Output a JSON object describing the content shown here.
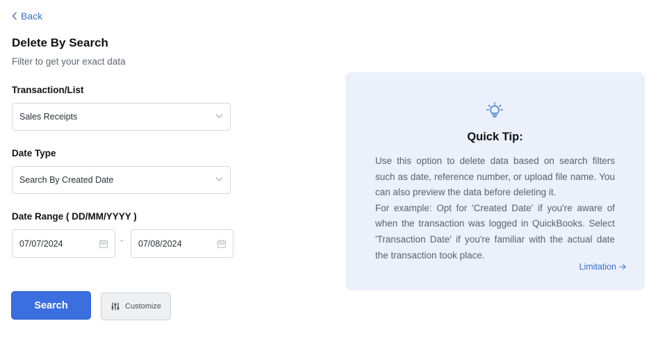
{
  "nav": {
    "back_label": "Back"
  },
  "header": {
    "title": "Delete By Search",
    "subtitle": "Filter to get your exact data"
  },
  "form": {
    "transaction": {
      "label": "Transaction/List",
      "value": "Sales Receipts"
    },
    "date_type": {
      "label": "Date Type",
      "value": "Search By Created Date"
    },
    "date_range": {
      "label": "Date Range ( DD/MM/YYYY )",
      "from": "07/07/2024",
      "separator": "-",
      "to": "07/08/2024"
    }
  },
  "actions": {
    "search_label": "Search",
    "customize_label": "Customize"
  },
  "tip": {
    "title": "Quick Tip:",
    "paragraph1": "Use this option to delete data based on search filters such as date, reference number, or upload file name. You can also preview the data before deleting it.",
    "paragraph2": "For example: Opt for 'Created Date' if you're aware of when the transaction was logged in QuickBooks. Select 'Transaction Date' if you're familiar with the actual date the transaction took place.",
    "link_label": "Limitation"
  },
  "colors": {
    "accent": "#3b6fe0",
    "link": "#3b6fd1",
    "tip_background": "#ebf0fb"
  },
  "icons": {
    "back": "chevron-left-icon",
    "select": "chevron-down-icon",
    "date": "calendar-icon",
    "customize": "sliders-icon",
    "tip": "lightbulb-icon",
    "link": "arrow-right-icon"
  }
}
